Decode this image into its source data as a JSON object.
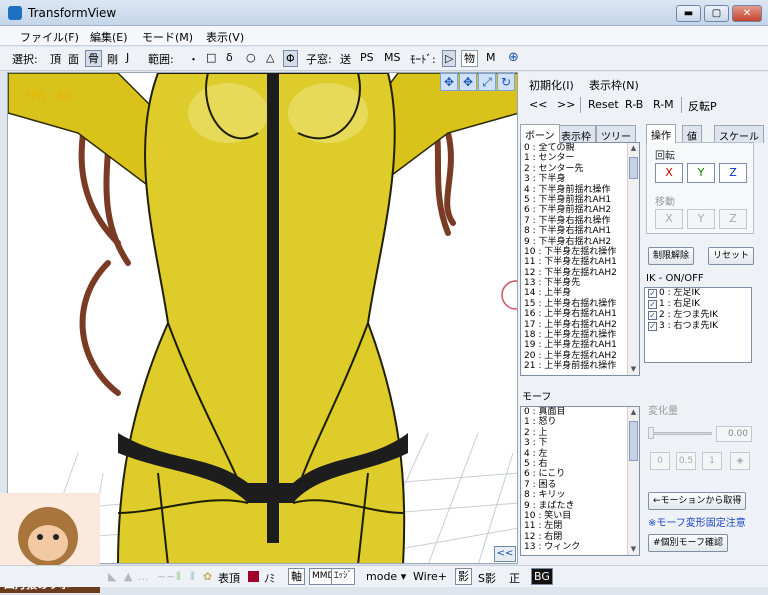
{
  "window": {
    "title": "TransformView",
    "btn_min": "▬",
    "btn_max": "▢",
    "btn_close": "✕"
  },
  "menu": [
    "ファイル(F)",
    "編集(E)",
    "モード(M)",
    "表示(V)"
  ],
  "toolbar": {
    "select_label": "選択:",
    "select_items": [
      "頂",
      "面",
      "骨",
      "剛",
      "J"
    ],
    "range_label": "範囲:",
    "range_items": [
      "・",
      "□",
      "δ",
      "○",
      "△",
      "Φ"
    ],
    "subwin_label": "子窓:",
    "subwin_items": [
      "送",
      "PS",
      "MS"
    ],
    "mode_label": "ﾓｰﾄﾞ:",
    "mode_items": [
      "▷",
      "物",
      "M"
    ],
    "globe": "⊕"
  },
  "viewport": {
    "fps": "FPS : 60",
    "icons": [
      "✥",
      "✥",
      "⤢",
      "↻"
    ]
  },
  "statusbar": {
    "items": [
      "表頂",
      "ﾉﾐ",
      "軸",
      "MMD",
      "ｴｯｼﾞ",
      "mode ▾",
      "Wire+",
      "影",
      "S影",
      "正",
      "BG"
    ],
    "faint": [
      "◣",
      "▲",
      "...",
      "~~",
      "⦀",
      "⦀",
      "✿"
    ],
    "collapse": "<<"
  },
  "watermark": "四月猿のラボ",
  "panel": {
    "top_buttons": [
      "初期化(I)",
      "表示枠(N)"
    ],
    "nav_buttons": [
      "<<",
      ">>",
      "Reset",
      "R-B",
      "R-M",
      "反転P"
    ],
    "bone_tabs": [
      "ボーン",
      "表示枠",
      "ツリー"
    ],
    "bones": [
      "0 : 全ての親",
      "1 : センター",
      "2 : センター先",
      "3 : 下半身",
      "4 : 下半身前揺れ操作",
      "5 : 下半身前揺れAH1",
      "6 : 下半身前揺れAH2",
      "7 : 下半身右揺れ操作",
      "8 : 下半身右揺れAH1",
      "9 : 下半身右揺れAH2",
      "10 : 下半身左揺れ操作",
      "11 : 下半身左揺れAH1",
      "12 : 下半身左揺れAH2",
      "13 : 下半身先",
      "14 : 上半身",
      "15 : 上半身右揺れ操作",
      "16 : 上半身右揺れAH1",
      "17 : 上半身右揺れAH2",
      "18 : 上半身左揺れ操作",
      "19 : 上半身左揺れAH1",
      "20 : 上半身左揺れAH2",
      "21 : 上半身前揺れ操作"
    ],
    "op_tabs": [
      "操作",
      "値",
      "スケール"
    ],
    "rotate_label": "回転",
    "move_label": "移動",
    "axes": [
      "X",
      "Y",
      "Z"
    ],
    "limit_release": "制限解除",
    "reset": "リセット",
    "ik_label": "IK - ON/OFF",
    "ik_items": [
      "0 : 左足IK",
      "1 : 右足IK",
      "2 : 左つま先IK",
      "3 : 右つま先IK"
    ],
    "morph_label": "モーフ",
    "morphs": [
      "0 : 真面目",
      "1 : 怒り",
      "2 : 上",
      "3 : 下",
      "4 : 左",
      "5 : 右",
      "6 : にこり",
      "7 : 困る",
      "8 : キリッ",
      "9 : まばたき",
      "10 : 笑い目",
      "11 : 左閉",
      "12 : 右閉",
      "13 : ウィンク"
    ],
    "change_amount_label": "変化量",
    "change_value": "0.00",
    "preset_buttons": [
      "0",
      "0.5",
      "1"
    ],
    "motion_btn": "←モーションから取得",
    "morph_note": "※モーフ変形固定注意",
    "individual_morph": "#個別モーフ確認"
  }
}
